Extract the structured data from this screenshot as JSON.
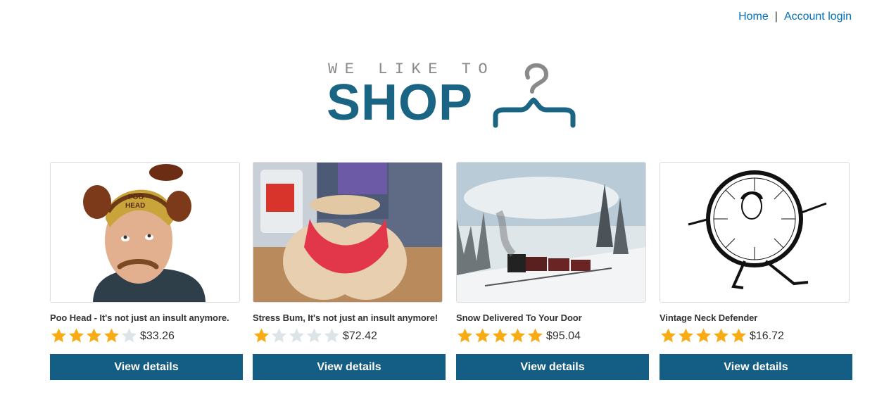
{
  "nav": {
    "home_label": "Home",
    "separator": "|",
    "account_label": "Account login"
  },
  "logo": {
    "tagline": "WE LIKE TO",
    "wordmark": "SHOP"
  },
  "colors": {
    "link": "#0071bc",
    "brand": "#1a6484",
    "button": "#145e85",
    "star_filled": "#f7ac16",
    "star_empty": "#dde4e8"
  },
  "products": [
    {
      "title": "Poo Head - It's not just an insult anymore.",
      "rating": 4,
      "price": "$33.26",
      "button_label": "View details"
    },
    {
      "title": "Stress Bum, It's not just an insult anymore!",
      "rating": 1,
      "price": "$72.42",
      "button_label": "View details"
    },
    {
      "title": "Snow Delivered To Your Door",
      "rating": 5,
      "price": "$95.04",
      "button_label": "View details"
    },
    {
      "title": "Vintage Neck Defender",
      "rating": 5,
      "price": "$16.72",
      "button_label": "View details"
    }
  ]
}
